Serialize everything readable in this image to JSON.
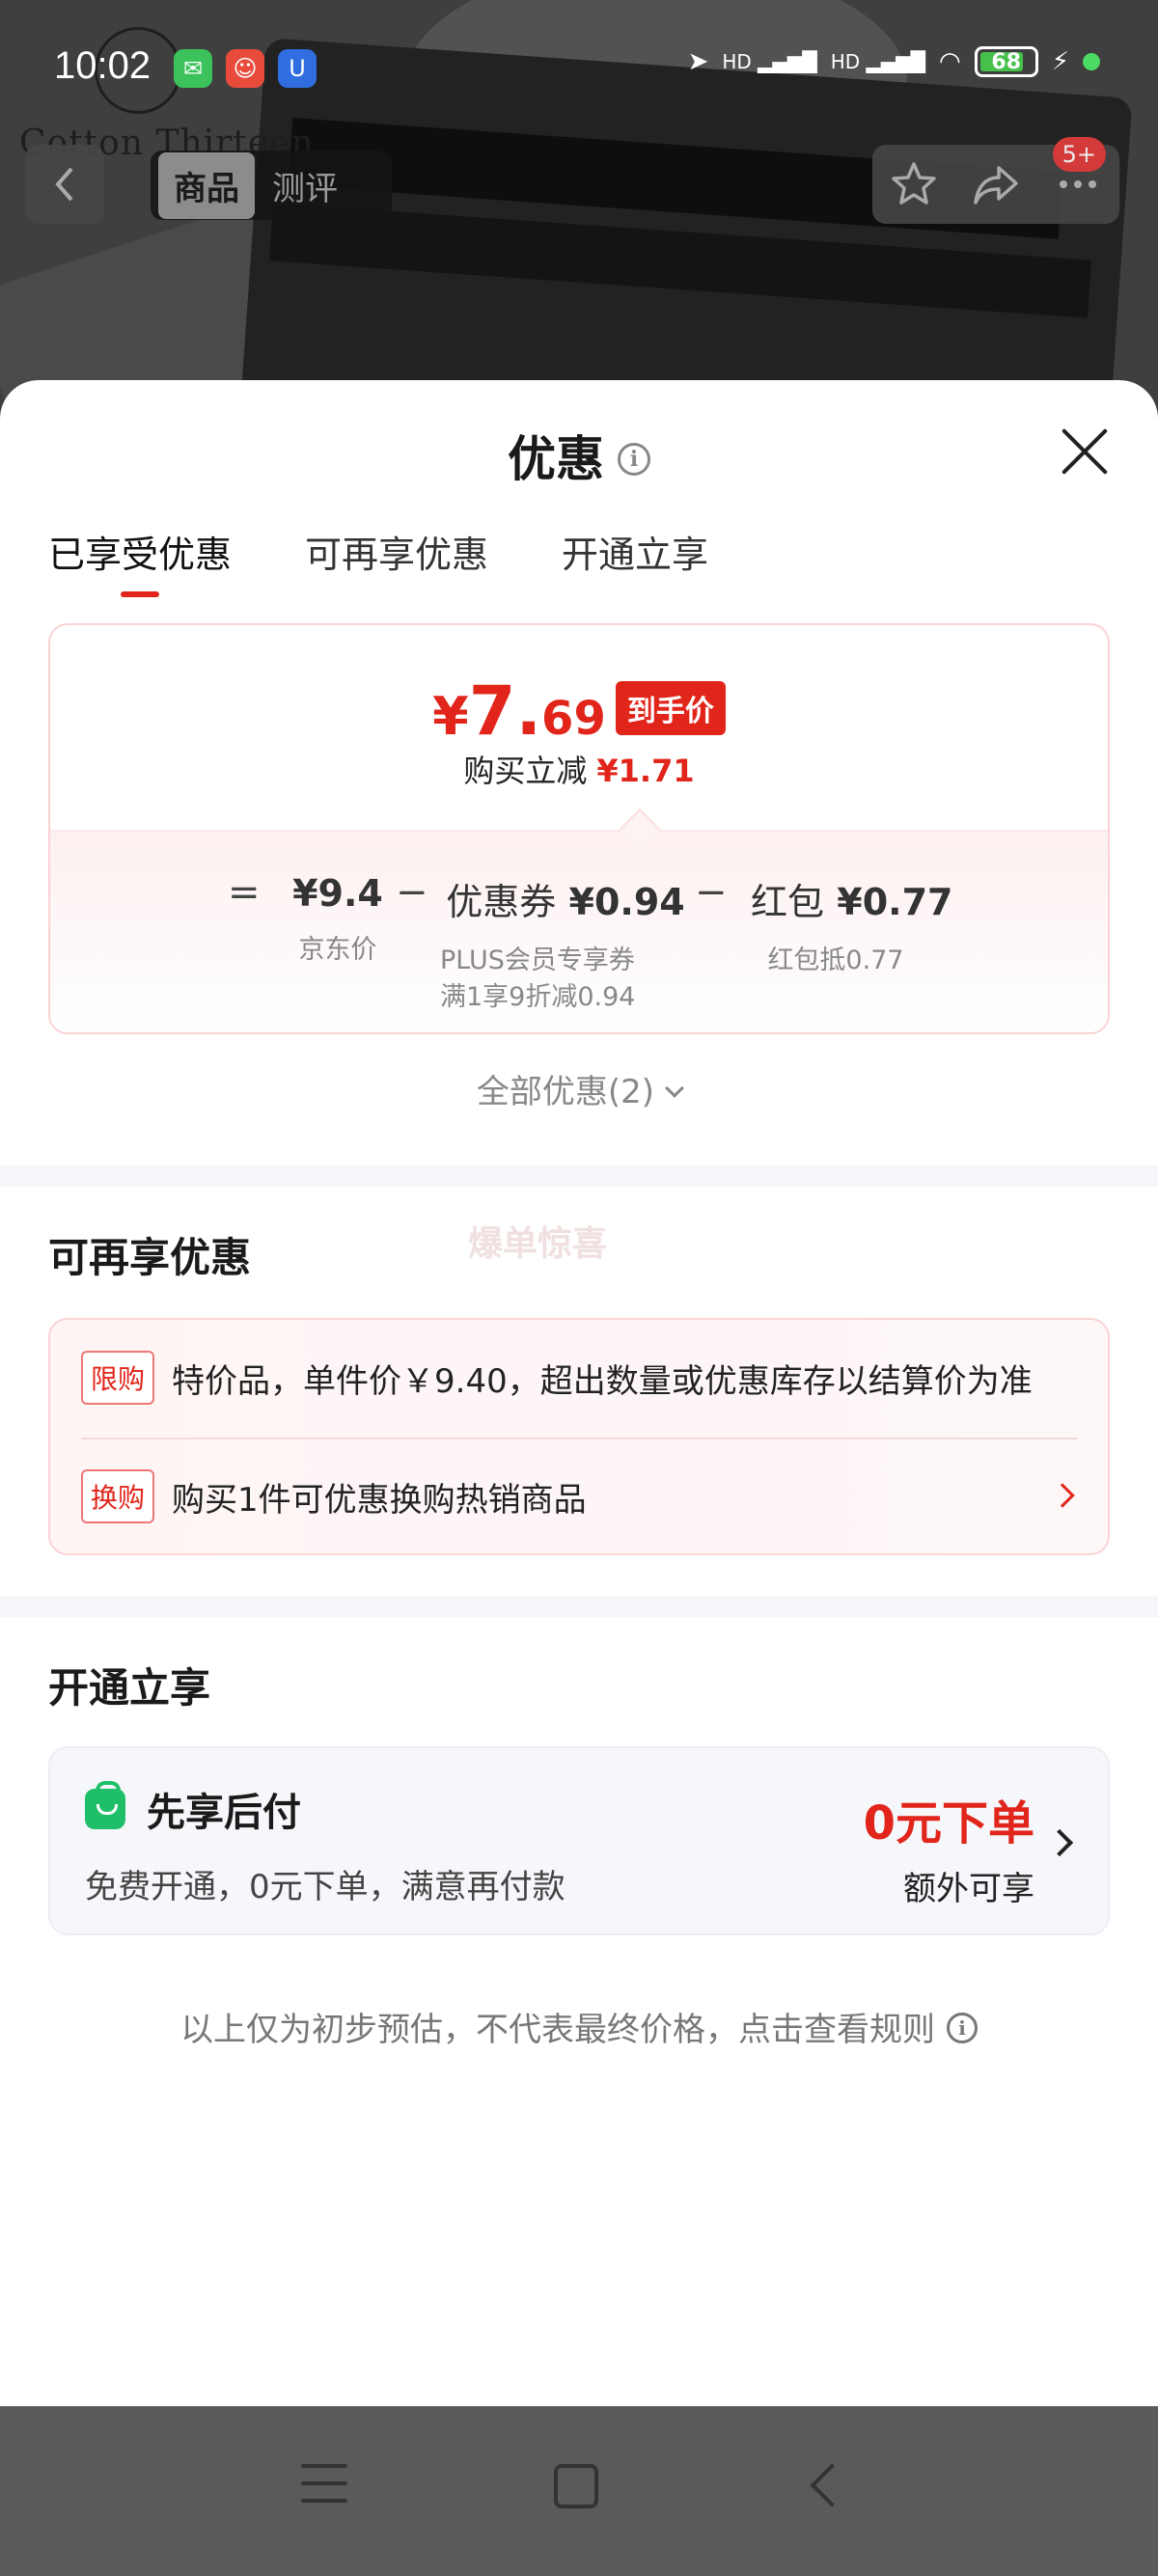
{
  "status_bar": {
    "time": "10:02",
    "battery": "68",
    "network1": "HD",
    "network2": "HD"
  },
  "background": {
    "brand": "Cotton Thirteen"
  },
  "top_nav": {
    "tab_product": "商品",
    "tab_review": "测评",
    "badge": "5+"
  },
  "sheet": {
    "title": "优惠",
    "tabs": [
      "已享受优惠",
      "可再享优惠",
      "开通立享"
    ],
    "price": {
      "yen": "¥",
      "integer": "7.",
      "decimal": "69",
      "tag": "到手价",
      "reduce_label": "购买立减",
      "reduce_value": "¥1.71"
    },
    "formula": {
      "eq": "=",
      "minus": "−",
      "jd_price": "¥9.4",
      "jd_label": "京东价",
      "coupon_label": "优惠券",
      "coupon_value": "¥0.94",
      "coupon_desc1": "PLUS会员专享券",
      "coupon_desc2": "满1享9折减0.94",
      "redpack_label": "红包",
      "redpack_value": "¥0.77",
      "redpack_desc": "红包抵0.77"
    },
    "all_discounts": "全部优惠(2)",
    "more_section": {
      "title": "可再享优惠",
      "ghost_text": "爆单惊喜",
      "items": [
        {
          "tag": "限购",
          "text": "特价品，单件价￥9.40，超出数量或优惠库存以结算价为准"
        },
        {
          "tag": "换购",
          "text": "购买1件可优惠换购热销商品"
        }
      ]
    },
    "open_section": {
      "title": "开通立享",
      "pay_title": "先享后付",
      "pay_desc": "免费开通，0元下单，满意再付款",
      "pay_highlight": "0元下单",
      "pay_extra": "额外可享"
    },
    "footnote": "以上仅为初步预估，不代表最终价格，点击查看规则"
  },
  "colors": {
    "accent": "#e1251b",
    "green": "#1fbf6a"
  }
}
